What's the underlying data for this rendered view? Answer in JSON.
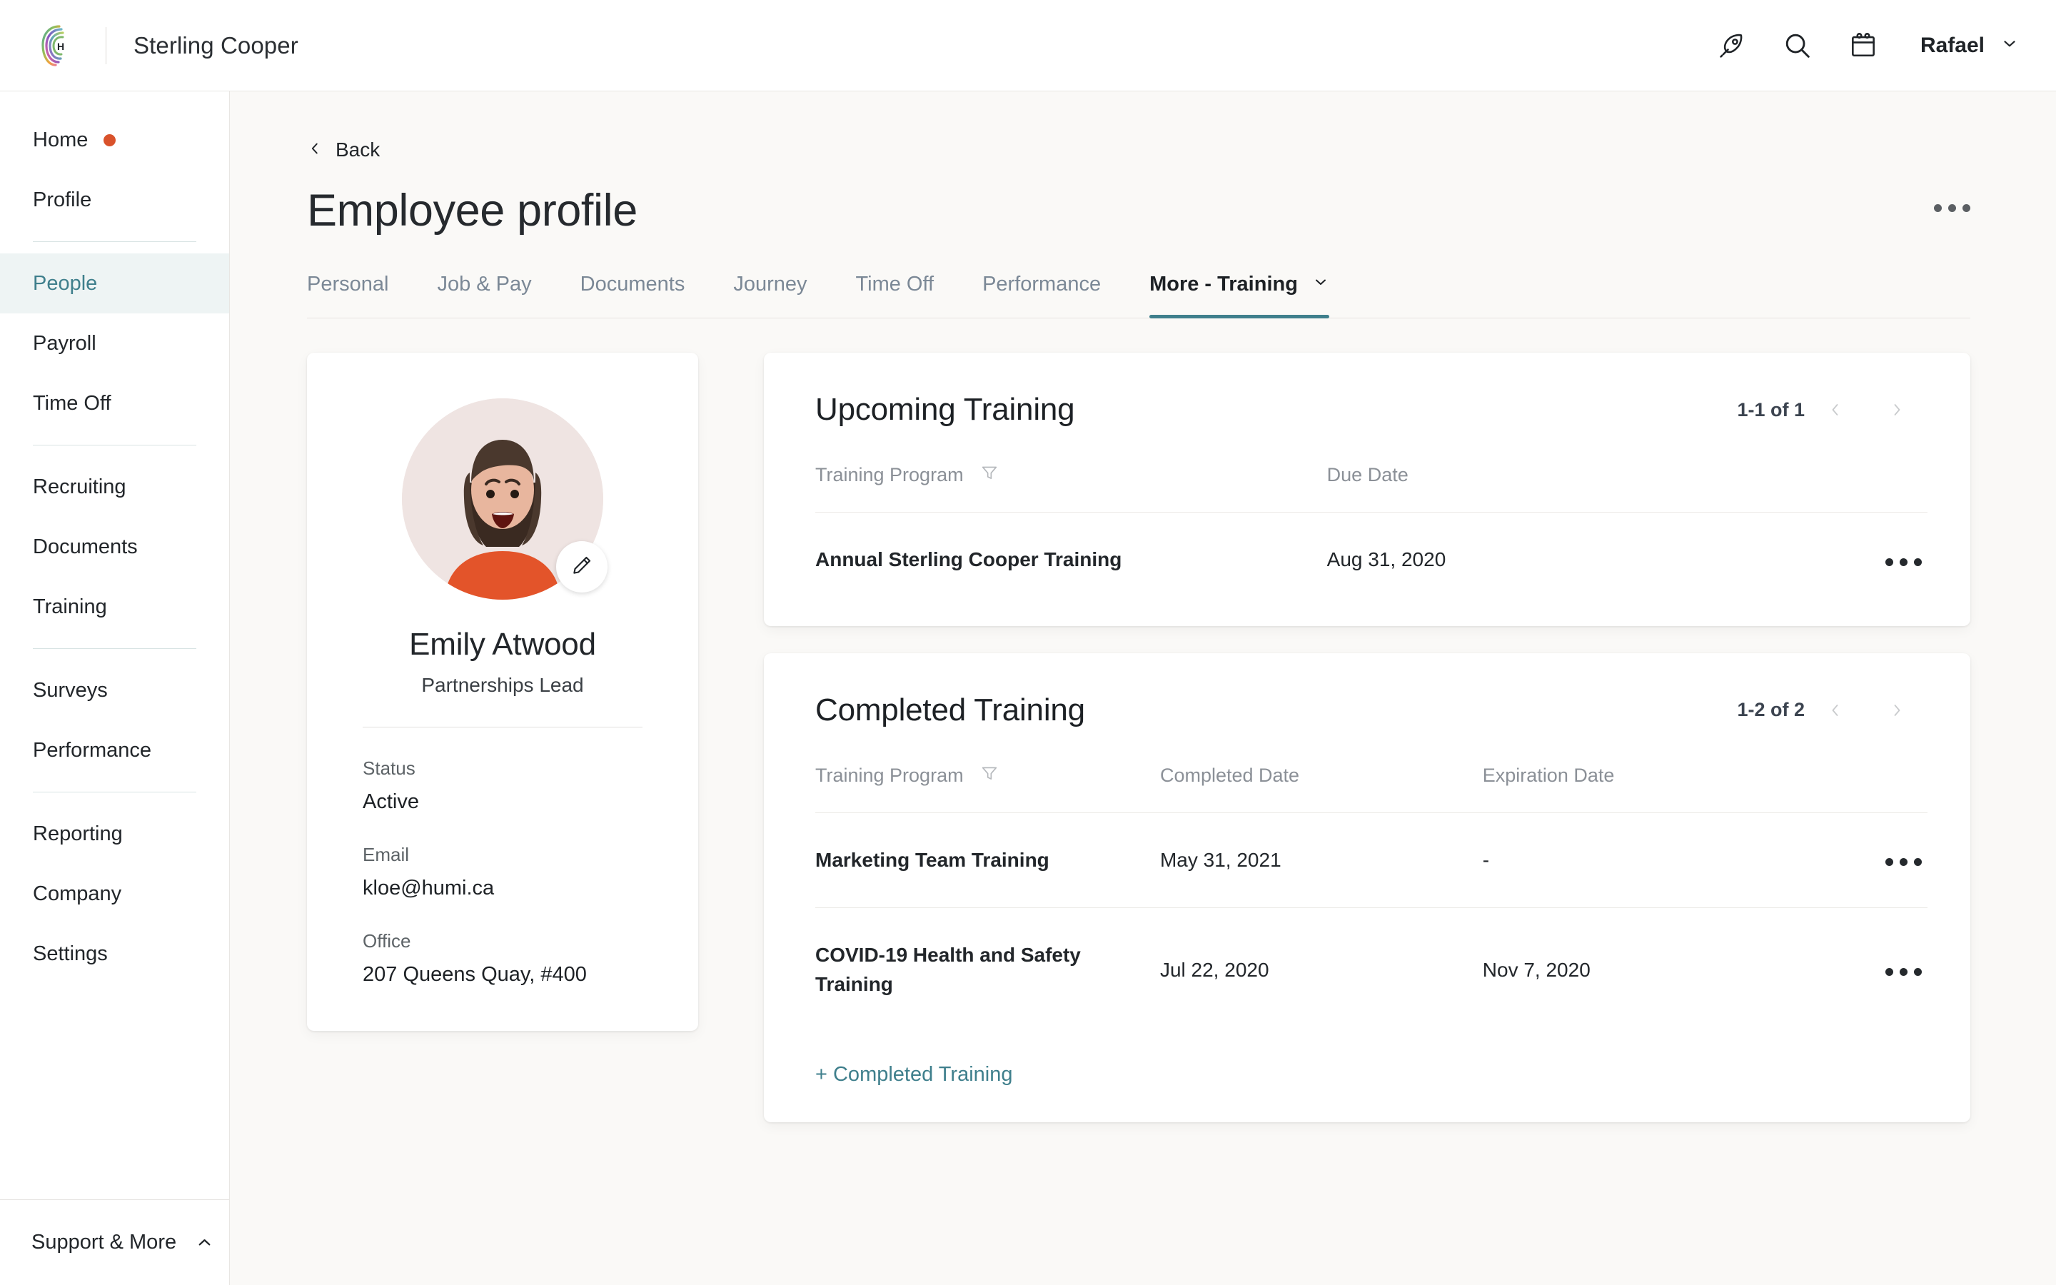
{
  "topbar": {
    "brand_name": "Sterling Cooper",
    "logo_icon": "humi-spiral-logo",
    "icons": [
      {
        "name": "rocket-icon",
        "label": "Rocket"
      },
      {
        "name": "search-icon",
        "label": "Search"
      },
      {
        "name": "calendar-icon",
        "label": "Calendar"
      }
    ],
    "user_name": "Rafael",
    "user_chevron": "chevron-down-icon"
  },
  "sidebar": {
    "groups": [
      {
        "items": [
          {
            "label": "Home",
            "badge_dot": true,
            "active": false
          },
          {
            "label": "Profile",
            "badge_dot": false,
            "active": false
          }
        ]
      },
      {
        "items": [
          {
            "label": "People",
            "badge_dot": false,
            "active": true
          },
          {
            "label": "Payroll",
            "badge_dot": false,
            "active": false
          },
          {
            "label": "Time Off",
            "badge_dot": false,
            "active": false
          }
        ]
      },
      {
        "items": [
          {
            "label": "Recruiting",
            "badge_dot": false,
            "active": false
          },
          {
            "label": "Documents",
            "badge_dot": false,
            "active": false
          },
          {
            "label": "Training",
            "badge_dot": false,
            "active": false
          }
        ]
      },
      {
        "items": [
          {
            "label": "Surveys",
            "badge_dot": false,
            "active": false
          },
          {
            "label": "Performance",
            "badge_dot": false,
            "active": false
          }
        ]
      },
      {
        "items": [
          {
            "label": "Reporting",
            "badge_dot": false,
            "active": false
          },
          {
            "label": "Company",
            "badge_dot": false,
            "active": false
          },
          {
            "label": "Settings",
            "badge_dot": false,
            "active": false
          }
        ]
      }
    ],
    "footer": {
      "label": "Support & More",
      "chevron": "chevron-up-icon"
    }
  },
  "page": {
    "back_label": "Back",
    "back_icon": "chevron-left-icon",
    "title": "Employee profile",
    "overflow_menu": "kebab-menu-icon"
  },
  "tabs": [
    {
      "label": "Personal",
      "active": false
    },
    {
      "label": "Job & Pay",
      "active": false
    },
    {
      "label": "Documents",
      "active": false
    },
    {
      "label": "Journey",
      "active": false
    },
    {
      "label": "Time Off",
      "active": false
    },
    {
      "label": "Performance",
      "active": false
    },
    {
      "label": "More - Training",
      "active": true,
      "chevron": "chevron-down-icon"
    }
  ],
  "profile": {
    "avatar_icon": "employee-avatar-illustration",
    "edit_icon": "pencil-edit-icon",
    "name": "Emily Atwood",
    "role": "Partnerships Lead",
    "fields": [
      {
        "label": "Status",
        "value": "Active"
      },
      {
        "label": "Email",
        "value": "kloe@humi.ca"
      },
      {
        "label": "Office",
        "value": "207 Queens Quay, #400"
      }
    ]
  },
  "upcoming_training": {
    "title": "Upcoming Training",
    "pager": {
      "count": "1-1 of 1",
      "prev_icon": "chevron-left-icon",
      "next_icon": "chevron-right-icon"
    },
    "columns": [
      {
        "label": "Training Program",
        "filter_icon": "funnel-filter-icon"
      },
      {
        "label": "Due Date",
        "filter_icon": null
      }
    ],
    "rows": [
      {
        "program": "Annual Sterling Cooper Training",
        "due_date": "Aug 31, 2020",
        "menu_icon": "kebab-menu-icon"
      }
    ]
  },
  "completed_training": {
    "title": "Completed Training",
    "pager": {
      "count": "1-2 of 2",
      "prev_icon": "chevron-left-icon",
      "next_icon": "chevron-right-icon"
    },
    "columns": [
      {
        "label": "Training Program",
        "filter_icon": "funnel-filter-icon"
      },
      {
        "label": "Completed Date",
        "filter_icon": null
      },
      {
        "label": "Expiration Date",
        "filter_icon": null
      }
    ],
    "rows": [
      {
        "program": "Marketing Team Training",
        "completed_date": "May 31, 2021",
        "expiration_date": "-",
        "menu_icon": "kebab-menu-icon"
      },
      {
        "program": "COVID-19 Health and Safety Training",
        "completed_date": "Jul 22, 2020",
        "expiration_date": "Nov 7, 2020",
        "menu_icon": "kebab-menu-icon"
      }
    ],
    "add_link": "+ Completed Training"
  },
  "colors": {
    "accent_teal": "#3f7f8c",
    "alert_dot": "#d9522b",
    "page_bg": "#faf9f7",
    "card_bg": "#ffffff",
    "text_primary": "#22262a",
    "text_muted": "#8b9097",
    "avatar_bg": "#efe4e2",
    "shirt": "#e3542a",
    "hair": "#4a382d"
  }
}
